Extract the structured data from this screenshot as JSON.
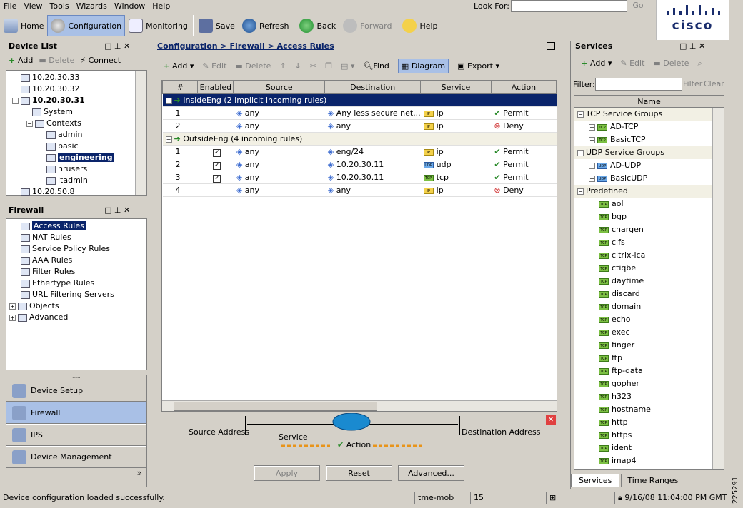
{
  "menu": [
    "File",
    "View",
    "Tools",
    "Wizards",
    "Window",
    "Help"
  ],
  "lookfor": {
    "label": "Look For:",
    "go": "Go",
    "value": ""
  },
  "logo": {
    "text": "cisco"
  },
  "toolbar": {
    "home": "Home",
    "configuration": "Configuration",
    "monitoring": "Monitoring",
    "save": "Save",
    "refresh": "Refresh",
    "back": "Back",
    "forward": "Forward",
    "help": "Help"
  },
  "device_list": {
    "title": "Device List",
    "add": "Add",
    "delete": "Delete",
    "connect": "Connect",
    "items": [
      "10.20.30.33",
      "10.20.30.32",
      "10.20.30.31",
      "System",
      "Contexts",
      "admin",
      "basic",
      "engineering",
      "hrusers",
      "itadmin",
      "10.20.50.8"
    ]
  },
  "firewall": {
    "title": "Firewall",
    "items": [
      "Access Rules",
      "NAT Rules",
      "Service Policy Rules",
      "AAA Rules",
      "Filter Rules",
      "Ethertype Rules",
      "URL Filtering Servers",
      "Objects",
      "Advanced"
    ]
  },
  "nav": [
    "Device Setup",
    "Firewall",
    "IPS",
    "Device Management"
  ],
  "breadcrumb": "Configuration > Firewall > Access Rules",
  "rules_toolbar": {
    "add": "Add",
    "edit": "Edit",
    "delete": "Delete",
    "find": "Find",
    "diagram": "Diagram",
    "export": "Export"
  },
  "columns": [
    "#",
    "Enabled",
    "Source",
    "Destination",
    "Service",
    "Action"
  ],
  "groups": [
    {
      "label": "InsideEng (2 implicit incoming rules)",
      "rows": [
        {
          "num": "1",
          "enabled": false,
          "source": "any",
          "dest": "Any less secure net...",
          "service": "ip",
          "svc_type": "IP",
          "action": "Permit"
        },
        {
          "num": "2",
          "enabled": false,
          "source": "any",
          "dest": "any",
          "service": "ip",
          "svc_type": "IP",
          "action": "Deny"
        }
      ]
    },
    {
      "label": "OutsideEng (4 incoming rules)",
      "rows": [
        {
          "num": "1",
          "enabled": true,
          "source": "any",
          "dest": "eng/24",
          "service": "ip",
          "svc_type": "IP",
          "action": "Permit"
        },
        {
          "num": "2",
          "enabled": true,
          "source": "any",
          "dest": "10.20.30.11",
          "service": "udp",
          "svc_type": "UDP",
          "action": "Permit"
        },
        {
          "num": "3",
          "enabled": true,
          "source": "any",
          "dest": "10.20.30.11",
          "service": "tcp",
          "svc_type": "TCP",
          "action": "Permit"
        },
        {
          "num": "4",
          "enabled": false,
          "source": "any",
          "dest": "any",
          "service": "ip",
          "svc_type": "IP",
          "action": "Deny"
        }
      ]
    }
  ],
  "diagram": {
    "source": "Source Address",
    "service": "Service",
    "action": "Action",
    "destination": "Destination Address"
  },
  "buttons": {
    "apply": "Apply",
    "reset": "Reset",
    "advanced": "Advanced..."
  },
  "services": {
    "title": "Services",
    "add": "Add",
    "edit": "Edit",
    "delete": "Delete",
    "filter_label": "Filter:",
    "filter_btn": "Filter",
    "clear_btn": "Clear",
    "column": "Name",
    "groups": [
      "TCP Service Groups",
      "UDP Service Groups",
      "Predefined"
    ],
    "tcp_groups": [
      "AD-TCP",
      "BasicTCP"
    ],
    "udp_groups": [
      "AD-UDP",
      "BasicUDP"
    ],
    "predefined": [
      "aol",
      "bgp",
      "chargen",
      "cifs",
      "citrix-ica",
      "ctiqbe",
      "daytime",
      "discard",
      "domain",
      "echo",
      "exec",
      "finger",
      "ftp",
      "ftp-data",
      "gopher",
      "h323",
      "hostname",
      "http",
      "https",
      "ident",
      "imap4"
    ],
    "tabs": [
      "Services",
      "Time Ranges"
    ]
  },
  "status": {
    "message": "Device configuration loaded successfully.",
    "host": "tme-mob",
    "level": "15",
    "datetime": "9/16/08 11:04:00 PM GMT"
  },
  "side_number": "225291"
}
